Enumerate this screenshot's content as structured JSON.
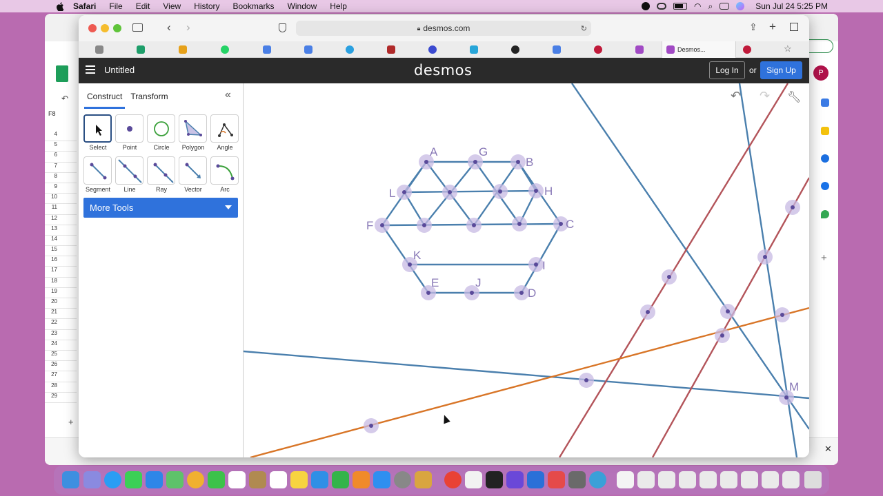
{
  "menubar": {
    "app": "Safari",
    "items": [
      "File",
      "Edit",
      "View",
      "History",
      "Bookmarks",
      "Window",
      "Help"
    ],
    "datetime": "Sun Jul 24  5:25 PM"
  },
  "browser": {
    "url": "desmos.com",
    "active_tab": "Desmos..."
  },
  "desmos": {
    "menu_icon": "hamburger-icon",
    "title": "Untitled",
    "logo": "desmos",
    "login": "Log In",
    "or": "or",
    "signup": "Sign Up"
  },
  "panel": {
    "tabs": [
      "Construct",
      "Transform"
    ],
    "tools": [
      "Select",
      "Point",
      "Circle",
      "Polygon",
      "Angle",
      "Segment",
      "Line",
      "Ray",
      "Vector",
      "Arc"
    ],
    "more_tools": "More Tools"
  },
  "graph": {
    "labels": [
      "A",
      "G",
      "B",
      "L",
      "H",
      "F",
      "C",
      "K",
      "I",
      "E",
      "J",
      "D",
      "M"
    ]
  },
  "sheets": {
    "cell_ref": "F8",
    "rows": [
      "4",
      "5",
      "6",
      "7",
      "8",
      "9",
      "10",
      "11",
      "12",
      "13",
      "14",
      "15",
      "16",
      "17",
      "18",
      "19",
      "20",
      "21",
      "22",
      "23",
      "24",
      "25",
      "26",
      "27",
      "28",
      "29"
    ]
  },
  "colors": {
    "blue_line": "#4a7fad",
    "red_line": "#b3545a",
    "orange_line": "#d87527",
    "point": "#5a4a9a",
    "point_halo": "#c7b9e3",
    "accent": "#2f72dc"
  }
}
